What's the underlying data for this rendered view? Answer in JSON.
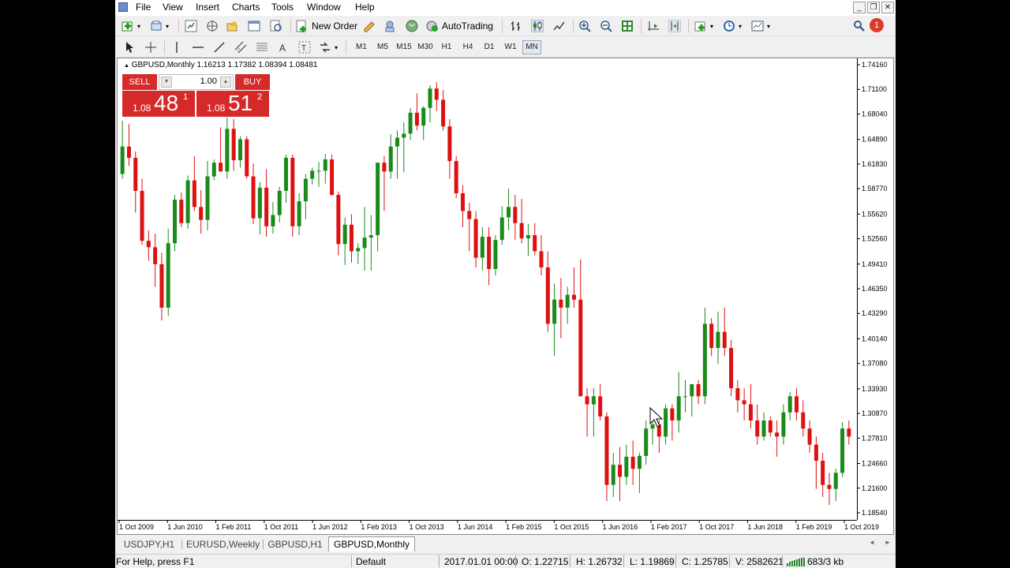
{
  "menu": [
    "File",
    "View",
    "Insert",
    "Charts",
    "Tools",
    "Window",
    "Help"
  ],
  "toolbar": {
    "new_order": "New Order",
    "auto_trading": "AutoTrading",
    "notification_badge": "1"
  },
  "timeframes": [
    "M1",
    "M5",
    "M15",
    "M30",
    "H1",
    "H4",
    "D1",
    "W1",
    "MN"
  ],
  "active_timeframe": "MN",
  "chart": {
    "title": "GBPUSD,Monthly  1.16213 1.17382 1.08394 1.08481",
    "trade_panel": {
      "sell_label": "SELL",
      "buy_label": "BUY",
      "lot": "1.00",
      "sell_price_prefix": "1.08",
      "sell_price_big": "48",
      "sell_price_sup": "1",
      "buy_price_prefix": "1.08",
      "buy_price_big": "51",
      "buy_price_sup": "2"
    },
    "bull_color": "#1a8a1a",
    "bear_color": "#dd1111"
  },
  "chart_data": {
    "type": "candlestick",
    "symbol": "GBPUSD",
    "timeframe": "Monthly",
    "y_ticks": [
      "1.74160",
      "1.71100",
      "1.68040",
      "1.64890",
      "1.61830",
      "1.58770",
      "1.55620",
      "1.52560",
      "1.49410",
      "1.46350",
      "1.43290",
      "1.40140",
      "1.37080",
      "1.33930",
      "1.30870",
      "1.27810",
      "1.24660",
      "1.21600",
      "1.18540"
    ],
    "x_ticks": [
      "1 Oct 2009",
      "1 Jun 2010",
      "1 Feb 2011",
      "1 Oct 2011",
      "1 Jun 2012",
      "1 Feb 2013",
      "1 Oct 2013",
      "1 Jun 2014",
      "1 Feb 2015",
      "1 Oct 2015",
      "1 Jun 2016",
      "1 Feb 2017",
      "1 Oct 2017",
      "1 Jun 2018",
      "1 Feb 2019",
      "1 Oct 2019"
    ],
    "y_range": [
      1.1854,
      1.7416
    ],
    "candles_ohlc": [
      [
        1.606,
        1.672,
        1.6,
        1.64
      ],
      [
        1.64,
        1.668,
        1.616,
        1.626
      ],
      [
        1.626,
        1.634,
        1.558,
        1.585
      ],
      [
        1.585,
        1.6,
        1.518,
        1.523
      ],
      [
        1.523,
        1.536,
        1.498,
        1.515
      ],
      [
        1.515,
        1.532,
        1.466,
        1.494
      ],
      [
        1.494,
        1.508,
        1.424,
        1.44
      ],
      [
        1.44,
        1.538,
        1.43,
        1.52
      ],
      [
        1.52,
        1.58,
        1.51,
        1.574
      ],
      [
        1.574,
        1.583,
        1.54,
        1.545
      ],
      [
        1.545,
        1.604,
        1.538,
        1.598
      ],
      [
        1.598,
        1.628,
        1.56,
        1.565
      ],
      [
        1.565,
        1.586,
        1.532,
        1.549
      ],
      [
        1.549,
        1.622,
        1.536,
        1.603
      ],
      [
        1.603,
        1.624,
        1.598,
        1.62
      ],
      [
        1.62,
        1.664,
        1.61,
        1.609
      ],
      [
        1.609,
        1.676,
        1.6,
        1.662
      ],
      [
        1.662,
        1.674,
        1.61,
        1.623
      ],
      [
        1.623,
        1.653,
        1.614,
        1.649
      ],
      [
        1.649,
        1.653,
        1.6,
        1.603
      ],
      [
        1.603,
        1.619,
        1.544,
        1.551
      ],
      [
        1.551,
        1.596,
        1.531,
        1.589
      ],
      [
        1.589,
        1.612,
        1.528,
        1.541
      ],
      [
        1.541,
        1.571,
        1.532,
        1.555
      ],
      [
        1.555,
        1.59,
        1.546,
        1.585
      ],
      [
        1.585,
        1.63,
        1.57,
        1.626
      ],
      [
        1.626,
        1.63,
        1.528,
        1.541
      ],
      [
        1.541,
        1.582,
        1.53,
        1.572
      ],
      [
        1.572,
        1.606,
        1.55,
        1.6
      ],
      [
        1.6,
        1.614,
        1.593,
        1.61
      ],
      [
        1.61,
        1.621,
        1.59,
        1.61
      ],
      [
        1.61,
        1.631,
        1.594,
        1.624
      ],
      [
        1.624,
        1.63,
        1.579,
        1.58
      ],
      [
        1.58,
        1.584,
        1.505,
        1.519
      ],
      [
        1.519,
        1.552,
        1.493,
        1.543
      ],
      [
        1.543,
        1.556,
        1.496,
        1.51
      ],
      [
        1.51,
        1.52,
        1.494,
        1.514
      ],
      [
        1.514,
        1.565,
        1.486,
        1.527
      ],
      [
        1.527,
        1.555,
        1.486,
        1.53
      ],
      [
        1.53,
        1.62,
        1.51,
        1.62
      ],
      [
        1.62,
        1.628,
        1.56,
        1.609
      ],
      [
        1.609,
        1.655,
        1.6,
        1.64
      ],
      [
        1.64,
        1.66,
        1.6,
        1.651
      ],
      [
        1.651,
        1.67,
        1.608,
        1.656
      ],
      [
        1.656,
        1.688,
        1.648,
        1.682
      ],
      [
        1.682,
        1.706,
        1.66,
        1.666
      ],
      [
        1.666,
        1.69,
        1.648,
        1.688
      ],
      [
        1.688,
        1.716,
        1.67,
        1.712
      ],
      [
        1.712,
        1.72,
        1.684,
        1.698
      ],
      [
        1.698,
        1.71,
        1.66,
        1.665
      ],
      [
        1.665,
        1.674,
        1.6,
        1.622
      ],
      [
        1.622,
        1.628,
        1.576,
        1.582
      ],
      [
        1.582,
        1.592,
        1.54,
        1.56
      ],
      [
        1.56,
        1.57,
        1.51,
        1.55
      ],
      [
        1.55,
        1.56,
        1.49,
        1.502
      ],
      [
        1.502,
        1.54,
        1.486,
        1.528
      ],
      [
        1.528,
        1.54,
        1.468,
        1.488
      ],
      [
        1.488,
        1.53,
        1.48,
        1.524
      ],
      [
        1.524,
        1.566,
        1.518,
        1.552
      ],
      [
        1.552,
        1.588,
        1.536,
        1.565
      ],
      [
        1.565,
        1.58,
        1.524,
        1.545
      ],
      [
        1.545,
        1.575,
        1.52,
        1.526
      ],
      [
        1.526,
        1.544,
        1.504,
        1.53
      ],
      [
        1.53,
        1.545,
        1.505,
        1.51
      ],
      [
        1.51,
        1.53,
        1.48,
        1.49
      ],
      [
        1.49,
        1.51,
        1.41,
        1.42
      ],
      [
        1.42,
        1.47,
        1.38,
        1.45
      ],
      [
        1.45,
        1.477,
        1.402,
        1.44
      ],
      [
        1.44,
        1.466,
        1.42,
        1.456
      ],
      [
        1.456,
        1.49,
        1.44,
        1.45
      ],
      [
        1.45,
        1.5,
        1.33,
        1.33
      ],
      [
        1.33,
        1.34,
        1.28,
        1.32
      ],
      [
        1.32,
        1.34,
        1.28,
        1.33
      ],
      [
        1.33,
        1.345,
        1.3,
        1.305
      ],
      [
        1.305,
        1.31,
        1.2,
        1.22
      ],
      [
        1.22,
        1.26,
        1.205,
        1.245
      ],
      [
        1.245,
        1.267,
        1.2,
        1.23
      ],
      [
        1.23,
        1.27,
        1.22,
        1.255
      ],
      [
        1.255,
        1.275,
        1.22,
        1.24
      ],
      [
        1.24,
        1.26,
        1.21,
        1.256
      ],
      [
        1.256,
        1.3,
        1.245,
        1.29
      ],
      [
        1.29,
        1.302,
        1.27,
        1.295
      ],
      [
        1.295,
        1.3,
        1.26,
        1.28
      ],
      [
        1.28,
        1.32,
        1.27,
        1.315
      ],
      [
        1.315,
        1.32,
        1.275,
        1.3
      ],
      [
        1.3,
        1.36,
        1.285,
        1.33
      ],
      [
        1.33,
        1.35,
        1.31,
        1.33
      ],
      [
        1.33,
        1.342,
        1.305,
        1.345
      ],
      [
        1.345,
        1.35,
        1.32,
        1.33
      ],
      [
        1.33,
        1.44,
        1.32,
        1.42
      ],
      [
        1.42,
        1.427,
        1.38,
        1.39
      ],
      [
        1.39,
        1.435,
        1.37,
        1.41
      ],
      [
        1.41,
        1.44,
        1.38,
        1.39
      ],
      [
        1.39,
        1.4,
        1.33,
        1.34
      ],
      [
        1.34,
        1.35,
        1.31,
        1.325
      ],
      [
        1.325,
        1.34,
        1.3,
        1.32
      ],
      [
        1.32,
        1.345,
        1.29,
        1.3
      ],
      [
        1.3,
        1.32,
        1.27,
        1.28
      ],
      [
        1.28,
        1.31,
        1.275,
        1.3
      ],
      [
        1.3,
        1.305,
        1.28,
        1.285
      ],
      [
        1.285,
        1.3,
        1.255,
        1.28
      ],
      [
        1.28,
        1.32,
        1.27,
        1.31
      ],
      [
        1.31,
        1.335,
        1.3,
        1.33
      ],
      [
        1.33,
        1.34,
        1.3,
        1.31
      ],
      [
        1.31,
        1.325,
        1.28,
        1.29
      ],
      [
        1.29,
        1.3,
        1.26,
        1.27
      ],
      [
        1.27,
        1.28,
        1.215,
        1.25
      ],
      [
        1.25,
        1.26,
        1.205,
        1.22
      ],
      [
        1.22,
        1.235,
        1.195,
        1.215
      ],
      [
        1.215,
        1.24,
        1.2,
        1.235
      ],
      [
        1.235,
        1.298,
        1.23,
        1.29
      ],
      [
        1.29,
        1.3,
        1.27,
        1.28
      ]
    ]
  },
  "tabs": [
    "USDJPY,H1",
    "EURUSD,Weekly",
    "GBPUSD,H1",
    "GBPUSD,Monthly"
  ],
  "active_tab": "GBPUSD,Monthly",
  "status": {
    "help": "For Help, press F1",
    "profile": "Default",
    "datetime": "2017.01.01 00:00",
    "open": "O: 1.22715",
    "high": "H: 1.26732",
    "low": "L: 1.19869",
    "close": "C: 1.25785",
    "volume": "V: 2582621",
    "traffic": "683/3 kb"
  }
}
